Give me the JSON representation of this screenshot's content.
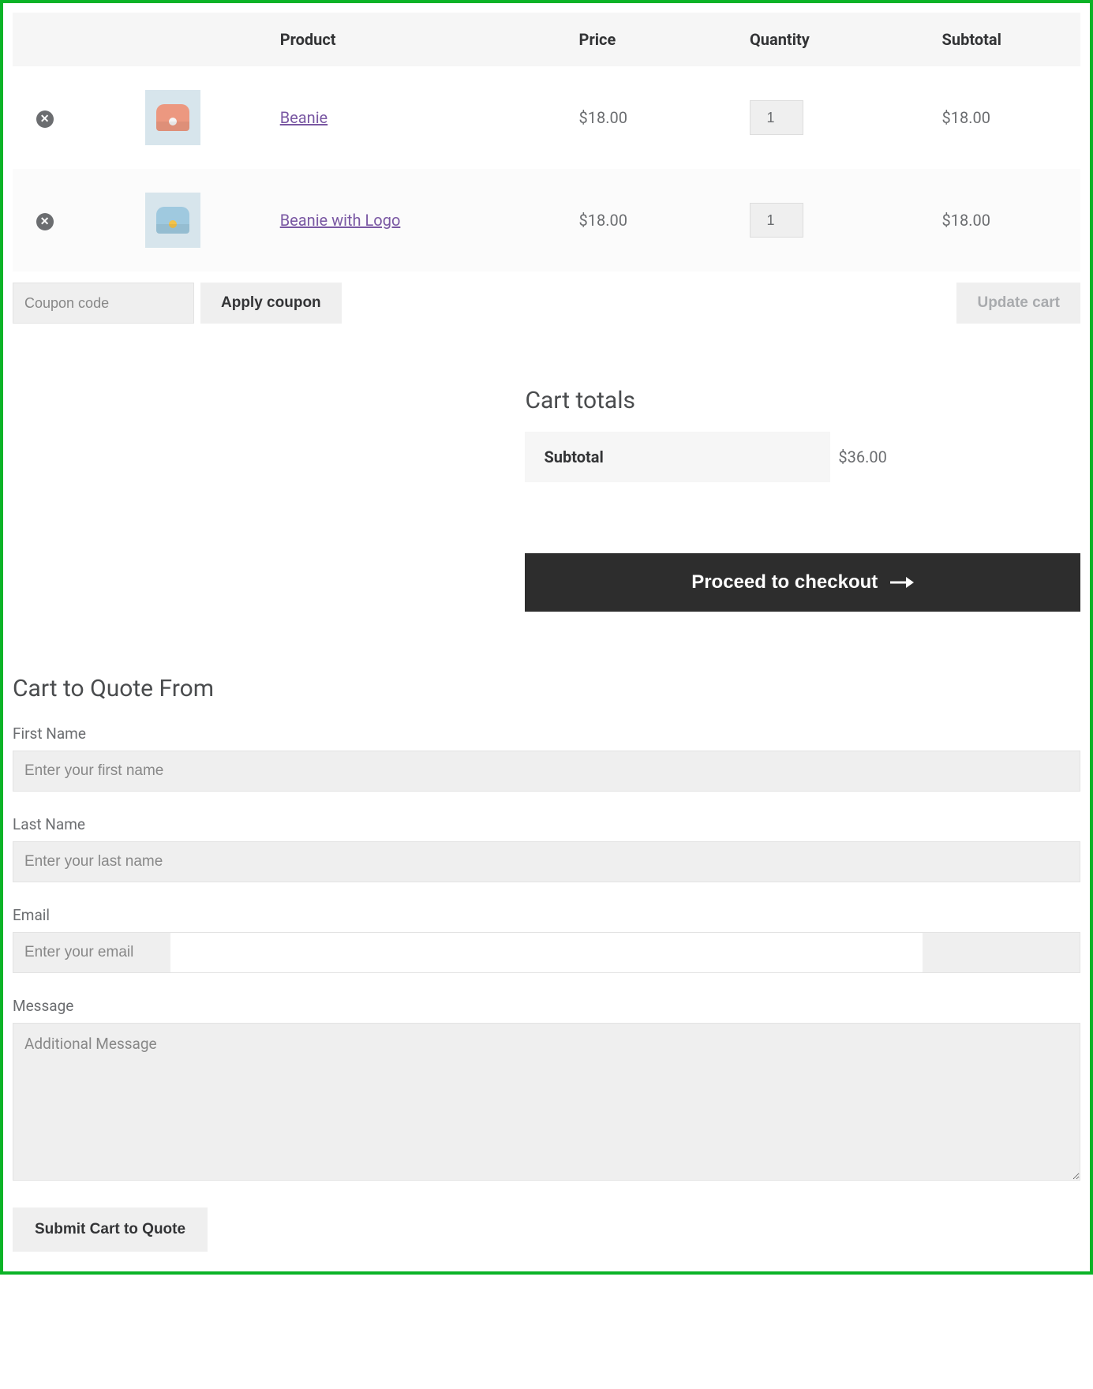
{
  "cart": {
    "headers": {
      "product": "Product",
      "price": "Price",
      "quantity": "Quantity",
      "subtotal": "Subtotal"
    },
    "items": [
      {
        "name": "Beanie",
        "price": "$18.00",
        "quantity": "1",
        "subtotal": "$18.00",
        "thumb_variant": "orange"
      },
      {
        "name": "Beanie with Logo",
        "price": "$18.00",
        "quantity": "1",
        "subtotal": "$18.00",
        "thumb_variant": "blue"
      }
    ],
    "coupon_placeholder": "Coupon code",
    "apply_coupon_label": "Apply coupon",
    "update_cart_label": "Update cart"
  },
  "totals": {
    "title": "Cart totals",
    "subtotal_label": "Subtotal",
    "subtotal_value": "$36.00",
    "checkout_label": "Proceed to checkout"
  },
  "quote": {
    "title": "Cart to Quote From",
    "first_name_label": "First Name",
    "first_name_placeholder": "Enter your first name",
    "last_name_label": "Last Name",
    "last_name_placeholder": "Enter your last name",
    "email_label": "Email",
    "email_placeholder": "Enter your email",
    "message_label": "Message",
    "message_placeholder": "Additional Message",
    "submit_label": "Submit Cart to Quote"
  }
}
